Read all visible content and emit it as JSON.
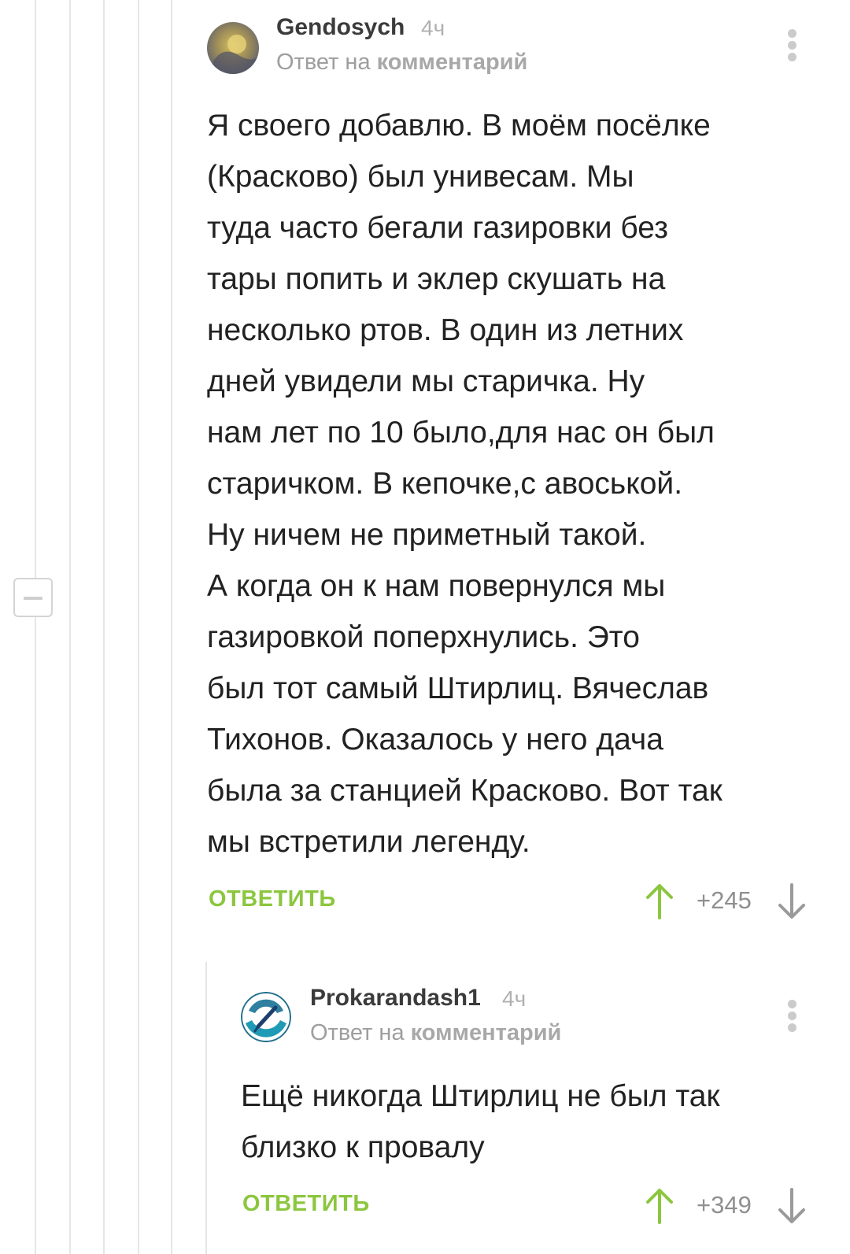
{
  "comments": [
    {
      "author": "Gendosych",
      "time": "4ч",
      "reply_prefix": "Ответ на",
      "reply_target": "комментарий",
      "lines": [
        "Я своего добавлю. В моём посёлке",
        "(Красково) был унивесам. Мы",
        "туда часто бегали газировки без",
        "тары попить и эклер скушать на",
        "несколько ртов. В один из летних",
        "дней увидели мы старичка. Ну",
        "нам лет по 10 было,для нас он был",
        "старичком. В кепочке,с авоськой.",
        "Ну ничем не приметный такой.",
        "А когда он к нам повернулся мы",
        "газировкой поперхнулись. Это",
        "был тот самый Штирлиц. Вячеслав",
        "Тихонов. Оказалось у него дача",
        "была за станцией Красково. Вот так",
        "мы встретили легенду."
      ],
      "reply_label": "ОТВЕТИТЬ",
      "rating": "+245"
    },
    {
      "author": "Prokarandash1",
      "time": "4ч",
      "reply_prefix": "Ответ на",
      "reply_target": "комментарий",
      "lines": [
        "Ещё никогда Штирлиц не был так",
        "близко к провалу"
      ],
      "reply_label": "ОТВЕТИТЬ",
      "rating": "+349"
    }
  ],
  "colors": {
    "accent": "#8cc63f",
    "thread_line": "#e6e6e6",
    "text": "#222222",
    "muted": "#9e9e9e"
  },
  "icons": {
    "menu": "more-vertical-icon",
    "upvote": "arrow-up-icon",
    "downvote": "arrow-down-icon",
    "collapse": "minus-icon"
  }
}
